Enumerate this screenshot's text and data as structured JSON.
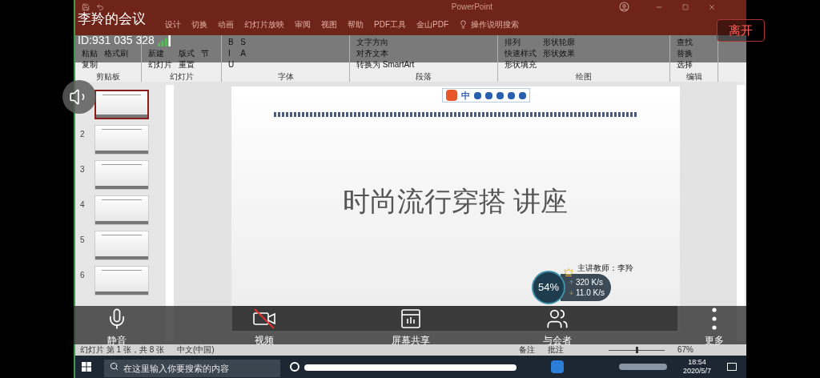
{
  "meeting": {
    "title": "李羚的会议",
    "id": "ID:931 035 328",
    "leave_button": "离开"
  },
  "powerpoint": {
    "window_title": "PowerPoint",
    "tabs": [
      {
        "label": "设计"
      },
      {
        "label": "切换"
      },
      {
        "label": "动画"
      },
      {
        "label": "幻灯片放映"
      },
      {
        "label": "审阅"
      },
      {
        "label": "视图"
      },
      {
        "label": "帮助"
      },
      {
        "label": "PDF工具"
      },
      {
        "label": "金山PDF"
      }
    ],
    "tell_me": "操作说明搜索",
    "ribbon_groups": [
      {
        "label": "剪贴板",
        "commands": [
          "粘贴",
          "复制",
          "格式刷"
        ]
      },
      {
        "label": "幻灯片",
        "commands": [
          "新建",
          "幻灯片",
          "版式",
          "重置",
          "节"
        ]
      },
      {
        "label": "字体",
        "commands": [
          "B",
          "I",
          "U",
          "S",
          "A"
        ]
      },
      {
        "label": "段落",
        "commands": [
          "文字方向",
          "对齐文本",
          "转换为 SmartArt"
        ]
      },
      {
        "label": "绘图",
        "commands": [
          "排列",
          "快速样式",
          "形状填充",
          "形状轮廓",
          "形状效果"
        ]
      },
      {
        "label": "编辑",
        "commands": [
          "查找",
          "替换",
          "选择"
        ]
      }
    ],
    "thumbnails": [
      {
        "selected": true
      },
      {
        "number": "2",
        "selected": false
      },
      {
        "number": "3",
        "selected": false
      },
      {
        "number": "4",
        "selected": false
      },
      {
        "number": "5",
        "selected": false
      },
      {
        "number": "6",
        "selected": false
      }
    ],
    "slide": {
      "ime_label": "中",
      "title": "时尚流行穿搭 讲座",
      "presenter": "主讲教师：李羚"
    },
    "status_bar": {
      "slide_info": "幻灯片 第 1 张，共 8 张",
      "language": "中文(中国)",
      "notes": "备注",
      "comments": "批注",
      "zoom_slider": {
        "level": 0.5
      },
      "zoom": "67%"
    },
    "taskbar": {
      "search_placeholder": "在这里输入你要搜索的内容",
      "time": "18:54",
      "date": "2020/5/7"
    }
  },
  "speed_widget": {
    "percent": "54%",
    "upload": "320 K/s",
    "download": "11.0 K/s"
  },
  "controls": [
    {
      "label": "静音",
      "kind": "mic"
    },
    {
      "label": "视频",
      "kind": "video",
      "muted": true
    },
    {
      "label": "屏幕共享",
      "kind": "share"
    },
    {
      "label": "与会者",
      "kind": "people"
    },
    {
      "label": "更多",
      "kind": "more"
    }
  ]
}
